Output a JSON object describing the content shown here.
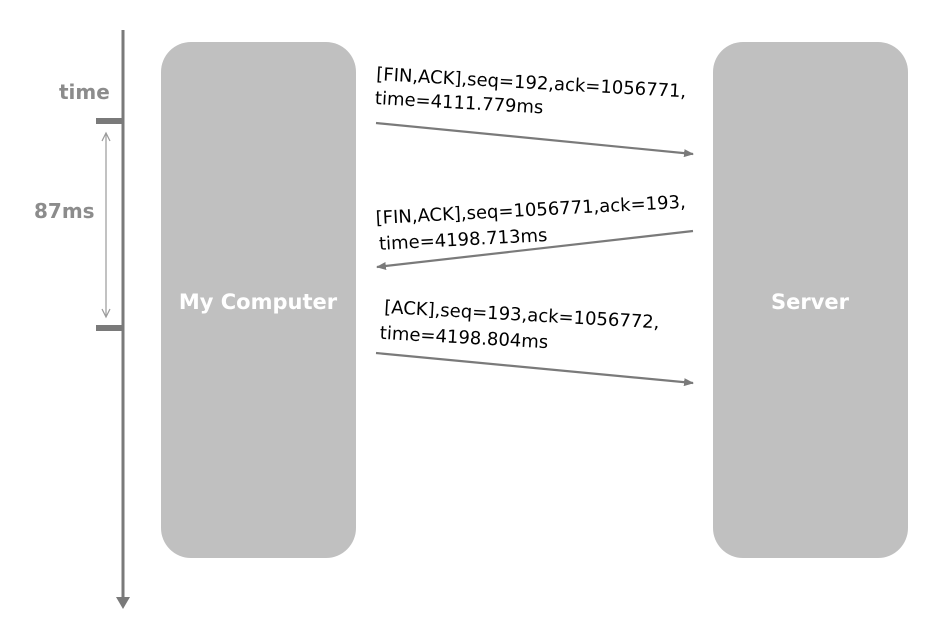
{
  "timeline": {
    "axis_label": "time",
    "interval_label": "87ms"
  },
  "endpoints": {
    "client": "My Computer",
    "server": "Server"
  },
  "messages": [
    {
      "direction": "client-to-server",
      "line1": "[FIN,ACK],seq=192,ack=1056771,",
      "line2": "time=4111.779ms"
    },
    {
      "direction": "server-to-client",
      "line1": "[FIN,ACK],seq=1056771,ack=193,",
      "line2": "time=4198.713ms"
    },
    {
      "direction": "client-to-server",
      "line1": "[ACK],seq=193,ack=1056772,",
      "line2": "time=4198.804ms"
    }
  ],
  "colors": {
    "box_fill": "#c0c0c0",
    "line": "#7a7a7a",
    "label": "#8c8c8c"
  }
}
